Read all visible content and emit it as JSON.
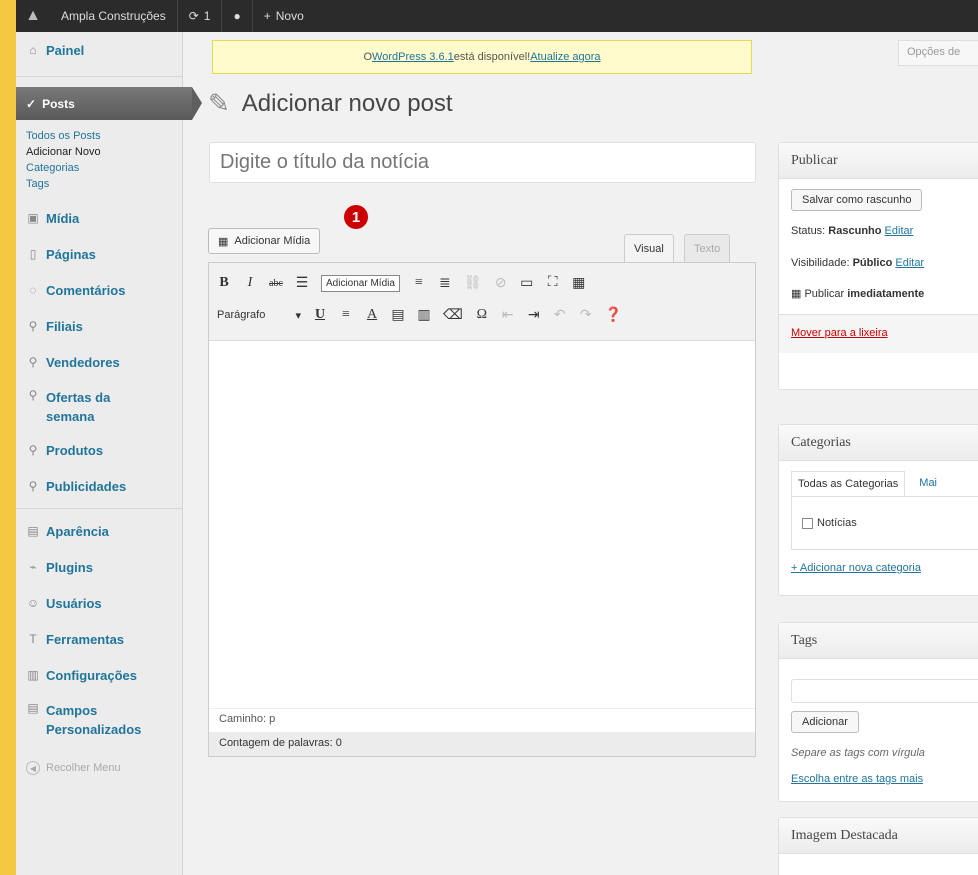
{
  "adminbar": {
    "site_name": "Ampla Construções",
    "updates_count": "1",
    "new_label": "Novo"
  },
  "sidebar": {
    "painel": "Painel",
    "posts": "Posts",
    "sub_all": "Todos os Posts",
    "sub_add": "Adicionar Novo",
    "sub_cats": "Categorias",
    "sub_tags": "Tags",
    "midia": "Mídia",
    "paginas": "Páginas",
    "comentarios": "Comentários",
    "filiais": "Filiais",
    "vendedores": "Vendedores",
    "ofertas_1": "Ofertas da",
    "ofertas_2": "semana",
    "produtos": "Produtos",
    "publicidades": "Publicidades",
    "aparencia": "Aparência",
    "plugins": "Plugins",
    "usuarios": "Usuários",
    "ferramentas": "Ferramentas",
    "configuracoes": "Configurações",
    "campos_1": "Campos",
    "campos_2": "Personalizados",
    "recolher": "Recolher Menu"
  },
  "notice": {
    "prefix": "O ",
    "link": "WordPress 3.6.1",
    "middle": " está disponível! ",
    "action": "Atualize agora"
  },
  "screen_options": "Opções de",
  "page_title": "Adicionar novo post",
  "title_placeholder": "Digite o título da notícia",
  "add_media": "Adicionar Mídia",
  "badge": "1",
  "tabs": {
    "visual": "Visual",
    "text": "Texto"
  },
  "toolbar": {
    "tooltip": "Adicionar Mídia",
    "format": "Parágrafo"
  },
  "editor": {
    "path": "Caminho: p",
    "wordcount": "Contagem de palavras: 0"
  },
  "publish": {
    "title": "Publicar",
    "save_draft": "Salvar como rascunho",
    "status_label": "Status: ",
    "status_value": "Rascunho",
    "edit": "Editar",
    "visibility_label": "Visibilidade: ",
    "visibility_value": "Público",
    "publish_label": "Publicar ",
    "publish_value": "imediatamente",
    "trash": "Mover para a lixeira"
  },
  "categories": {
    "title": "Categorias",
    "tab_all": "Todas as Categorias",
    "tab_other": "Mai",
    "item": "Notícias",
    "add_new": "+ Adicionar nova categoria"
  },
  "tags": {
    "title": "Tags",
    "add_button": "Adicionar",
    "hint": "Separe as tags com vírgula",
    "choose": "Escolha entre as tags mais"
  },
  "featured": {
    "title": "Imagem Destacada"
  }
}
